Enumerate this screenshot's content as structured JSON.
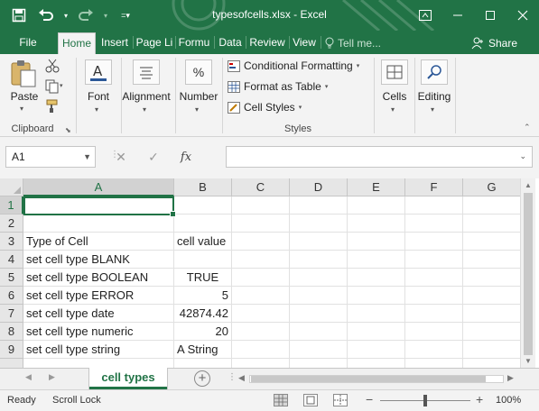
{
  "window": {
    "title": "typesofcells.xlsx - Excel",
    "restore_icon": "ribbon-display-options-icon",
    "min_icon": "minimize-icon",
    "max_icon": "maximize-icon",
    "close_icon": "close-icon"
  },
  "qat": {
    "save": "save-icon",
    "undo": "undo-icon",
    "redo": "redo-icon",
    "customize": "customize-qat-icon"
  },
  "tabs": {
    "file": "File",
    "home": "Home",
    "insert": "Insert",
    "page_layout": "Page Li",
    "formulas": "Formu",
    "data": "Data",
    "review": "Review",
    "view": "View",
    "tell_me": "Tell me...",
    "share": "Share"
  },
  "ribbon": {
    "paste": "Paste",
    "clipboard": "Clipboard",
    "font": "Font",
    "alignment": "Alignment",
    "number": "Number",
    "conditional_formatting": "Conditional Formatting",
    "format_as_table": "Format as Table",
    "cell_styles": "Cell Styles",
    "styles": "Styles",
    "cells": "Cells",
    "editing": "Editing",
    "number_symbol": "%"
  },
  "formula_bar": {
    "name_box": "A1",
    "cancel": "✕",
    "enter": "✓",
    "fx": "fx",
    "value": ""
  },
  "grid": {
    "columns": [
      "A",
      "B",
      "C",
      "D",
      "E",
      "F",
      "G"
    ],
    "rows": [
      "1",
      "2",
      "3",
      "4",
      "5",
      "6",
      "7",
      "8",
      "9"
    ],
    "cells": {
      "A3": "Type of Cell",
      "B3": "cell value",
      "A4": "set cell type BLANK",
      "B4": "",
      "A5": "set cell type BOOLEAN",
      "B5": "TRUE",
      "A6": "set cell type ERROR",
      "B6": "5",
      "A7": "set cell type date",
      "B7": "42874.42",
      "A8": "set cell type numeric",
      "B8": "20",
      "A9": "set cell type string",
      "B9": "A String"
    },
    "selected": "A1"
  },
  "sheets": {
    "active": "cell types",
    "add": "+"
  },
  "status": {
    "ready": "Ready",
    "scroll_lock": "Scroll Lock",
    "zoom": "100%",
    "zoom_minus": "−",
    "zoom_plus": "+"
  },
  "colors": {
    "brand": "#217346",
    "ribbon_bg": "#f3f3f3"
  }
}
